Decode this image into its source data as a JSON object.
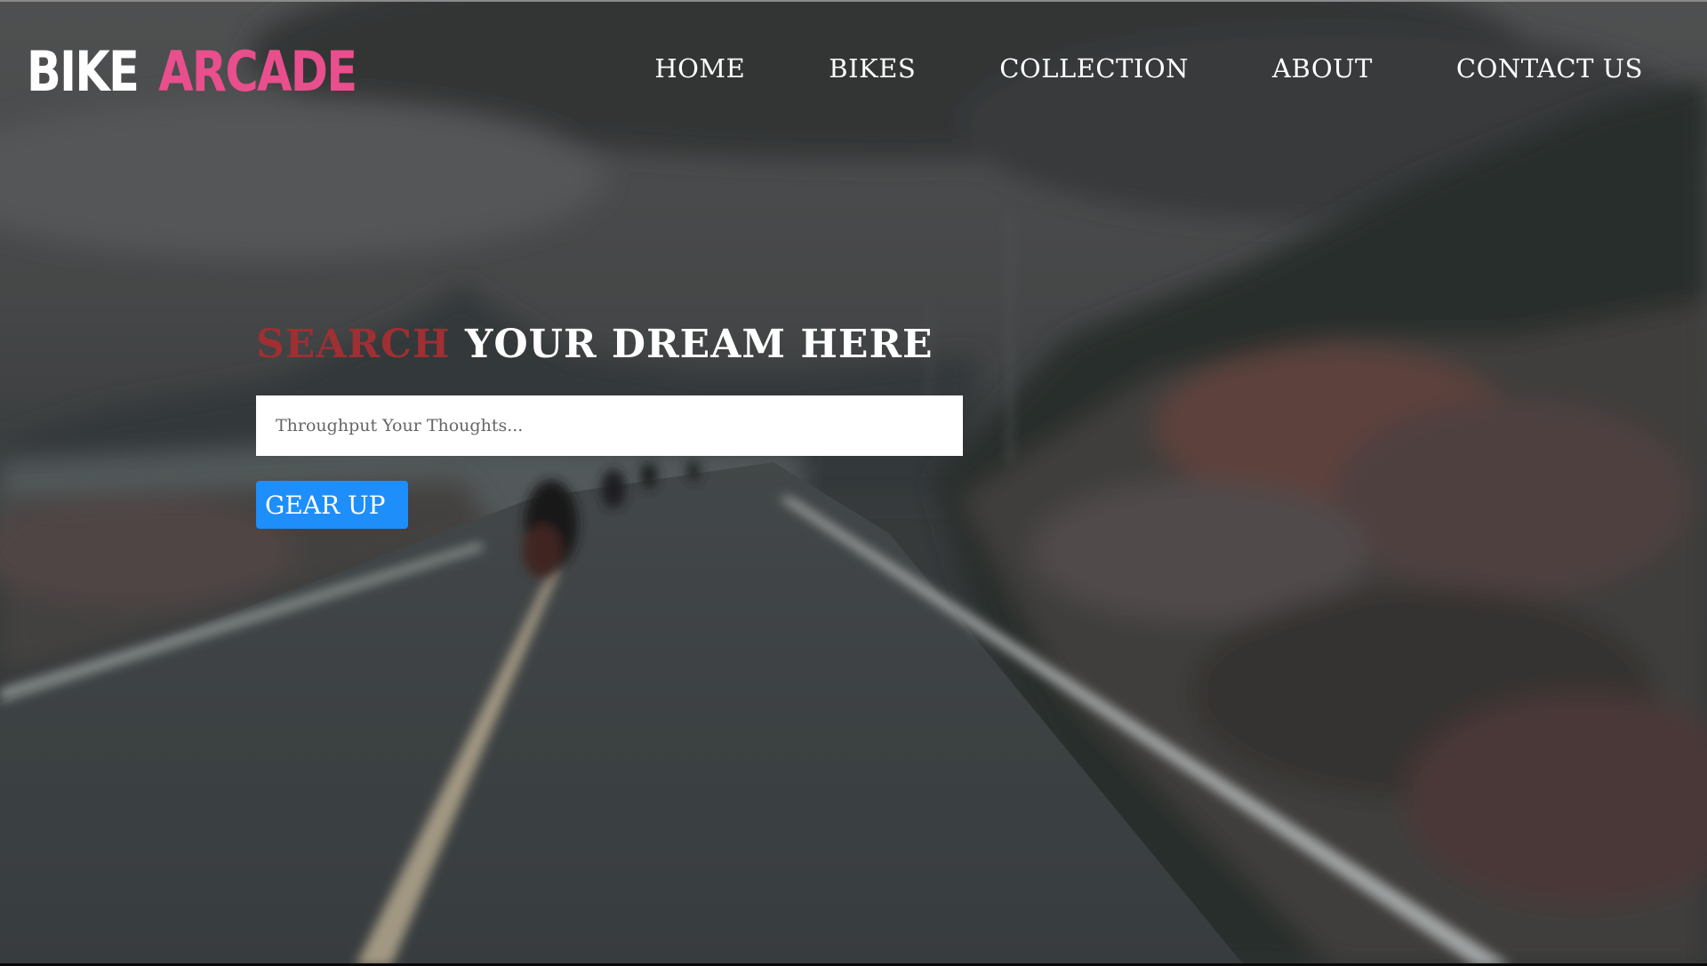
{
  "logo": {
    "part_a": "BIKE",
    "part_b": "ARCADE",
    "colors": {
      "part_a": "#ffffff",
      "part_b": "#e84f8c"
    }
  },
  "nav": {
    "items": [
      {
        "label": "HOME"
      },
      {
        "label": "BIKES"
      },
      {
        "label": "COLLECTION"
      },
      {
        "label": "ABOUT"
      },
      {
        "label": "CONTACT US"
      }
    ]
  },
  "hero": {
    "headline_accent": "SEARCH",
    "headline_rest": "YOUR DREAM HERE",
    "accent_color": "#9e2f33",
    "search": {
      "value": "",
      "placeholder": "Throughput Your Thoughts..."
    },
    "button_label": "GEAR UP",
    "button_color": "#1e8efa"
  }
}
